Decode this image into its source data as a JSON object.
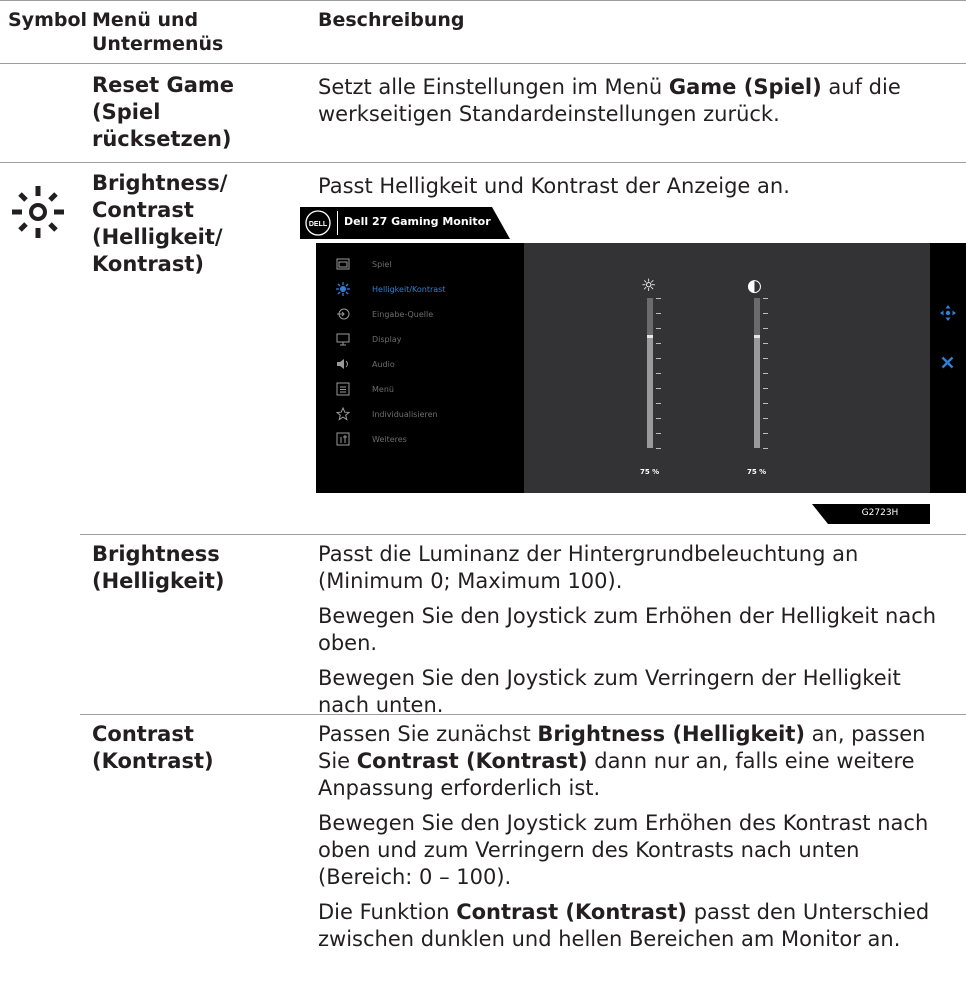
{
  "header": {
    "col_symbol": "Symbol",
    "col_menu_line1": "Menü und",
    "col_menu_line2": "Untermenüs",
    "col_desc": "Beschreibung"
  },
  "rows": {
    "reset": {
      "menu": [
        "Reset Game",
        "(Spiel",
        "rücksetzen)"
      ],
      "desc_pre": "Setzt alle Einstellungen im Menü ",
      "desc_bold": "Game (Spiel)",
      "desc_post": " auf die werkseitigen Standardeinstellungen zurück."
    },
    "brightness_contrast": {
      "icon": "sun-icon",
      "menu": [
        "Brightness/",
        "Contrast",
        "(Helligkeit/",
        "Kontrast)"
      ],
      "desc": "Passt Helligkeit und Kontrast der Anzeige an."
    },
    "brightness": {
      "menu": [
        "Brightness",
        "(Helligkeit)"
      ],
      "desc": [
        "Passt die Luminanz der Hintergrundbeleuchtung an (Minimum 0; Maximum 100).",
        "Bewegen Sie den Joystick zum Erhöhen der Helligkeit nach oben.",
        "Bewegen Sie den Joystick zum Verringern der Helligkeit nach unten."
      ]
    },
    "contrast": {
      "menu": [
        "Contrast",
        "(Kontrast)"
      ],
      "p1_a": "Passen Sie zunächst ",
      "p1_b": "Brightness (Helligkeit)",
      "p1_c": " an, passen Sie ",
      "p1_d": "Contrast (Kontrast)",
      "p1_e": " dann nur an, falls eine weitere Anpassung erforderlich ist.",
      "p2": "Bewegen Sie den Joystick zum Erhöhen des Kontrast nach oben und zum Verringern des Kontrasts nach unten (Bereich: 0 – 100).",
      "p3_a": "Die Funktion ",
      "p3_b": "Contrast (Kontrast)",
      "p3_c": " passt den Unterschied zwischen dunklen und hellen Bereichen am Monitor an."
    }
  },
  "osd": {
    "logo_text": "DELL",
    "title": "Dell 27 Gaming Monitor",
    "menu_items": [
      {
        "label": "Spiel",
        "icon": "game-icon",
        "active": false
      },
      {
        "label": "Helligkeit/Kontrast",
        "icon": "brightness-icon",
        "active": true
      },
      {
        "label": "Eingabe-Quelle",
        "icon": "input-source-icon",
        "active": false
      },
      {
        "label": "Display",
        "icon": "display-icon",
        "active": false
      },
      {
        "label": "Audio",
        "icon": "speaker-icon",
        "active": false
      },
      {
        "label": "Menü",
        "icon": "menu-icon",
        "active": false
      },
      {
        "label": "Individualisieren",
        "icon": "star-icon",
        "active": false
      },
      {
        "label": "Weiteres",
        "icon": "info-icon",
        "active": false
      }
    ],
    "brightness_value": "75 %",
    "contrast_value": "75 %",
    "brightness_level": 0.75,
    "contrast_level": 0.75,
    "model": "G2723H",
    "accent_color": "#2f7fd6"
  }
}
